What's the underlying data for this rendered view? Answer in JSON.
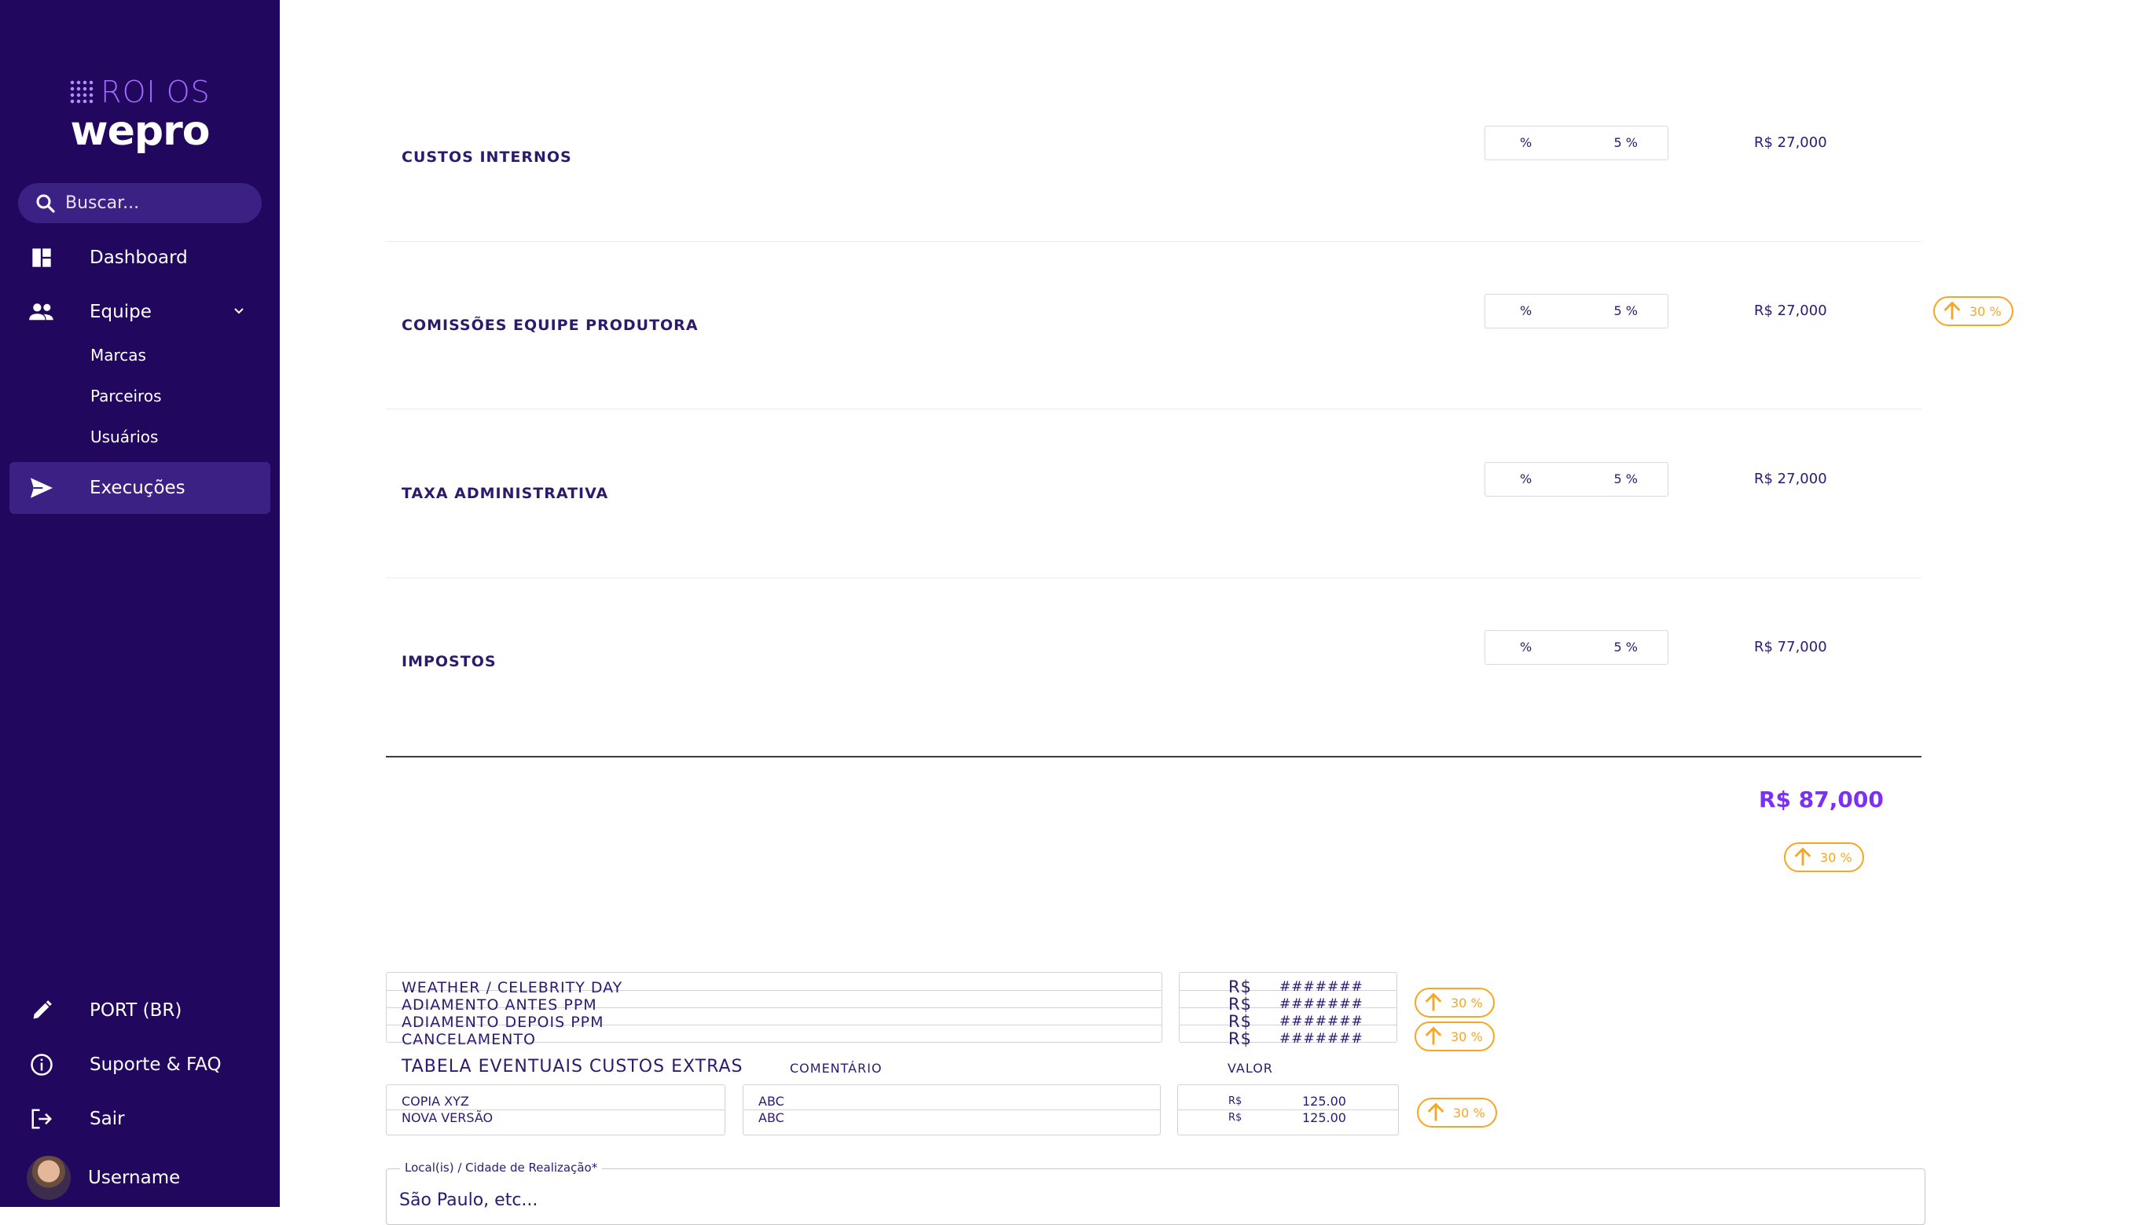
{
  "brand": {
    "product": "ROI OS",
    "name": "wepro"
  },
  "search": {
    "placeholder": "Buscar..."
  },
  "nav": {
    "dashboard": "Dashboard",
    "equipe": "Equipe",
    "sub": [
      "Marcas",
      "Parceiros",
      "Usuários"
    ],
    "execucoes": "Execuções"
  },
  "footer_nav": {
    "language": "PORT (BR)",
    "support": "Suporte & FAQ",
    "logout": "Sair",
    "username": "Username"
  },
  "costs": {
    "rows": [
      {
        "label": "CUSTOS INTERNOS",
        "pct_symbol": "%",
        "pct_value": "5 %",
        "amount": "R$  27,000",
        "badge": ""
      },
      {
        "label": "COMISSÕES EQUIPE PRODUTORA",
        "pct_symbol": "%",
        "pct_value": "5 %",
        "amount": "R$  27,000",
        "badge": "30 %"
      },
      {
        "label": "TAXA ADMINISTRATIVA",
        "pct_symbol": "%",
        "pct_value": "5 %",
        "amount": "R$  27,000",
        "badge": ""
      },
      {
        "label": "IMPOSTOS",
        "pct_symbol": "%",
        "pct_value": "5 %",
        "amount": "R$  77,000",
        "badge": ""
      }
    ],
    "total": "R$ 87,000",
    "total_badge": "30 %"
  },
  "contingencies": {
    "items": [
      {
        "label": "WEATHER / CELEBRITY DAY",
        "currency": "R$",
        "value": "#######"
      },
      {
        "label": "ADIAMENTO ANTES PPM",
        "currency": "R$",
        "value": "#######"
      },
      {
        "label": "ADIAMENTO DEPOIS PPM",
        "currency": "R$",
        "value": "#######"
      },
      {
        "label": "CANCELAMENTO",
        "currency": "R$",
        "value": "#######"
      }
    ],
    "badges": [
      "30 %",
      "30 %"
    ]
  },
  "extras_table": {
    "title": "TABELA EVENTUAIS CUSTOS EXTRAS",
    "col_comment": "COMENTÁRIO",
    "col_value": "VALOR",
    "rows": [
      {
        "name": "COPIA XYZ",
        "comment": "ABC",
        "currency": "R$",
        "value": "125.00"
      },
      {
        "name": "NOVA VERSÃO",
        "comment": "ABC",
        "currency": "R$",
        "value": "125.00"
      }
    ],
    "badge": "30 %"
  },
  "location_field": {
    "label": "Local(is) / Cidade de Realização*",
    "value": "São Paulo, etc..."
  },
  "colors": {
    "sidebar": "#22075e",
    "accent": "#7b2ff7",
    "badge": "#f6a623"
  }
}
